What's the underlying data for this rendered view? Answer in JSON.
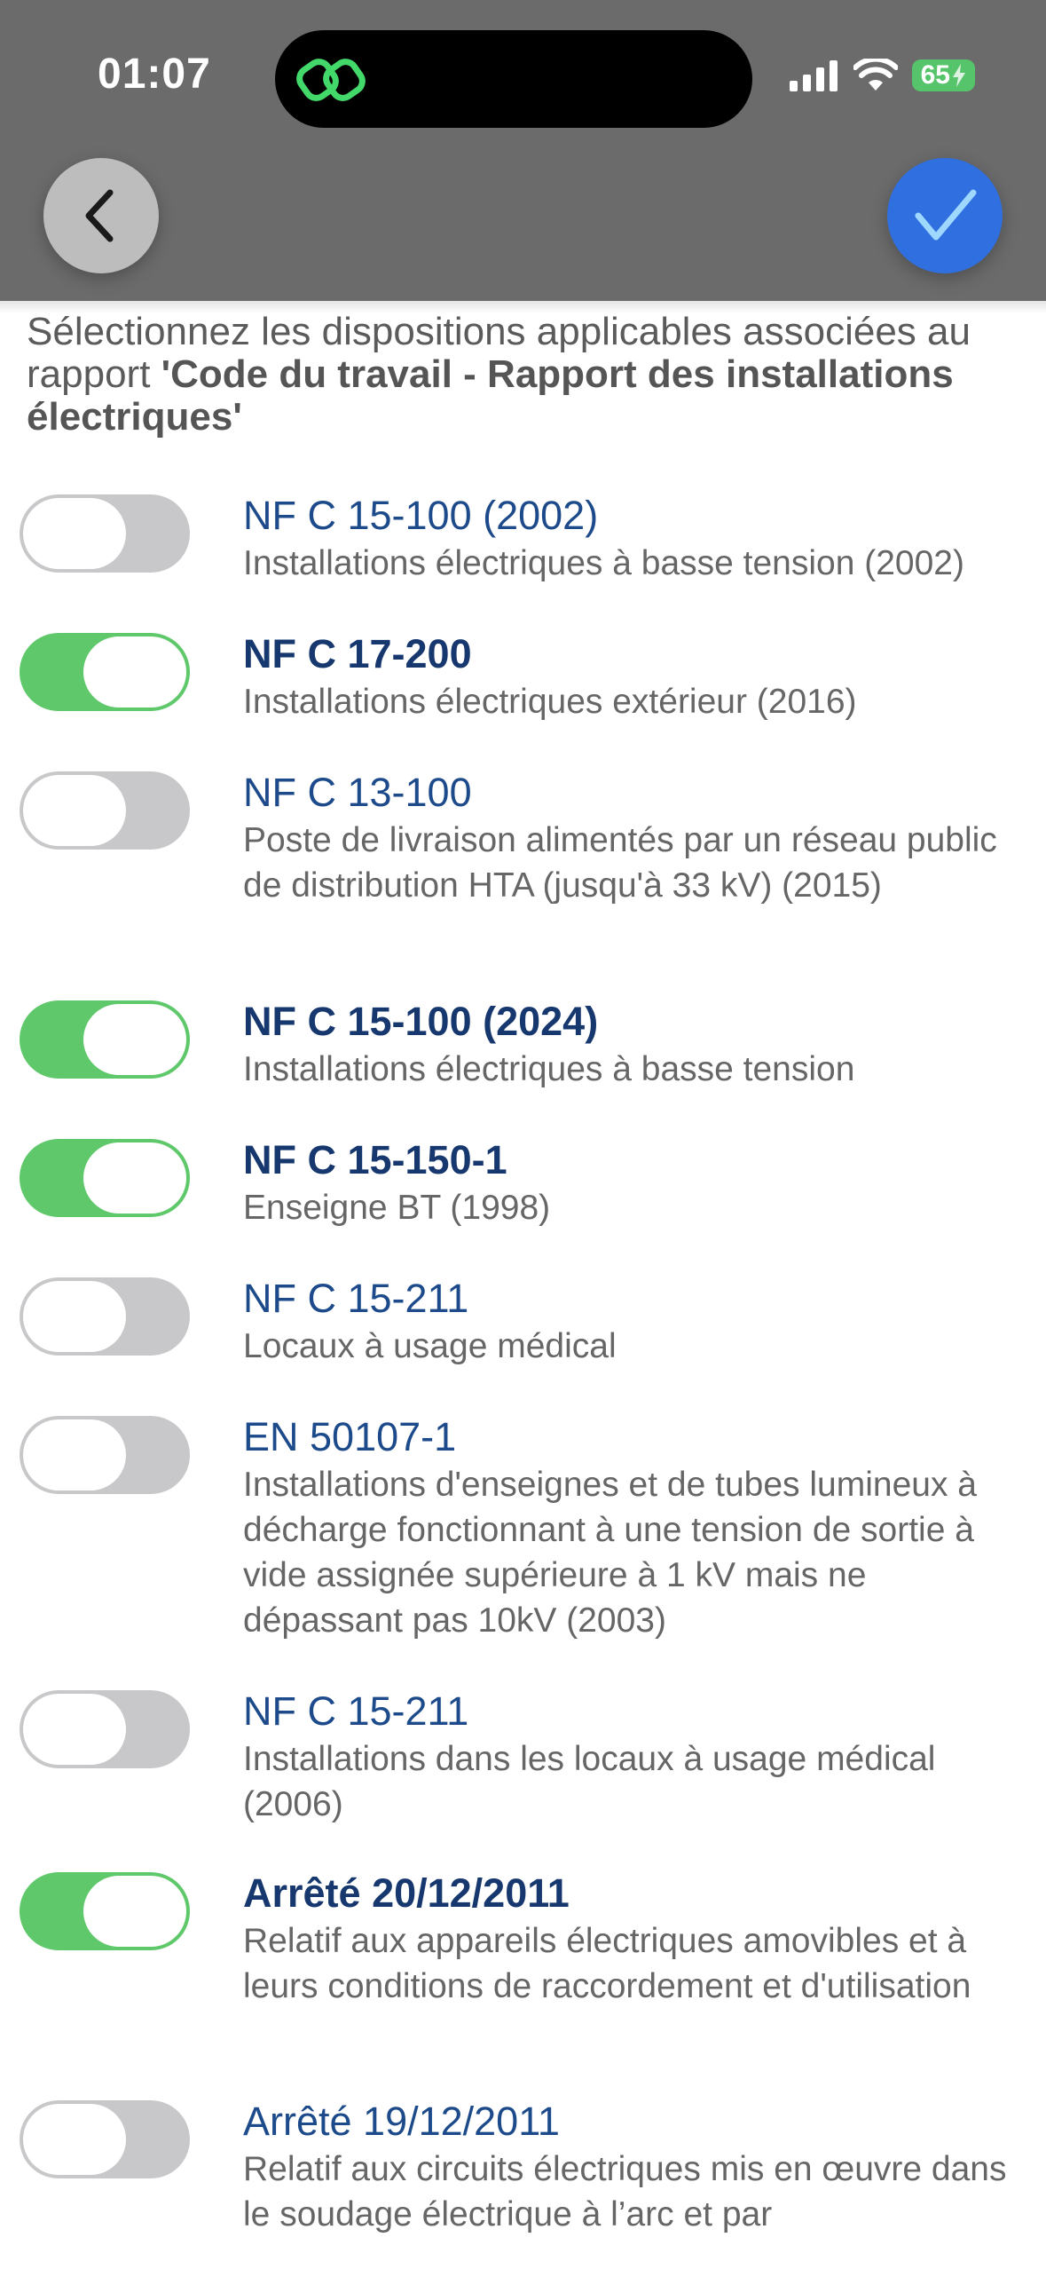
{
  "status_bar": {
    "time": "01:07",
    "battery": "65"
  },
  "colors": {
    "header_bg": "#6b6b6b",
    "toggle_on": "#5fc86a",
    "toggle_off": "#c8c8ca",
    "title": "#1c4a8a",
    "confirm": "#2f6fe0"
  },
  "intro": {
    "text": "Sélectionnez les dispositions applicables associées au rapport ",
    "report_name": "'Code du travail - Rapport des installations électriques'"
  },
  "items": [
    {
      "title": "NF C 15-100 (2002)",
      "description": "Installations électriques à basse tension (2002)",
      "checked": false
    },
    {
      "title": "NF C 17-200",
      "description": "Installations électriques extérieur (2016)",
      "checked": true
    },
    {
      "title": "NF C 13-100",
      "description": "Poste de livraison alimentés par un réseau public de distribution HTA (jusqu'à 33 kV) (2015)",
      "checked": false
    },
    {
      "title": "NF C 15-100 (2024)",
      "description": "Installations électriques à basse tension",
      "checked": true
    },
    {
      "title": "NF C 15-150-1",
      "description": "Enseigne BT (1998)",
      "checked": true
    },
    {
      "title": "NF C 15-211",
      "description": "Locaux à usage médical",
      "checked": false
    },
    {
      "title": "EN 50107-1",
      "description": "Installations d'enseignes et de tubes lumineux à décharge fonctionnant à une tension de sortie à vide assignée supérieure à 1 kV mais ne dépassant pas 10kV (2003)",
      "checked": false
    },
    {
      "title": "NF C 15-211",
      "description": "Installations dans les locaux à usage médical (2006)",
      "checked": false
    },
    {
      "title": "Arrêté 20/12/2011",
      "description": "Relatif aux appareils électriques amovibles et à leurs conditions de raccordement et d'utilisation",
      "checked": true
    },
    {
      "title": "Arrêté 19/12/2011",
      "description": "Relatif aux circuits électriques mis en œuvre dans le soudage électrique à l’arc et par",
      "checked": false
    }
  ]
}
